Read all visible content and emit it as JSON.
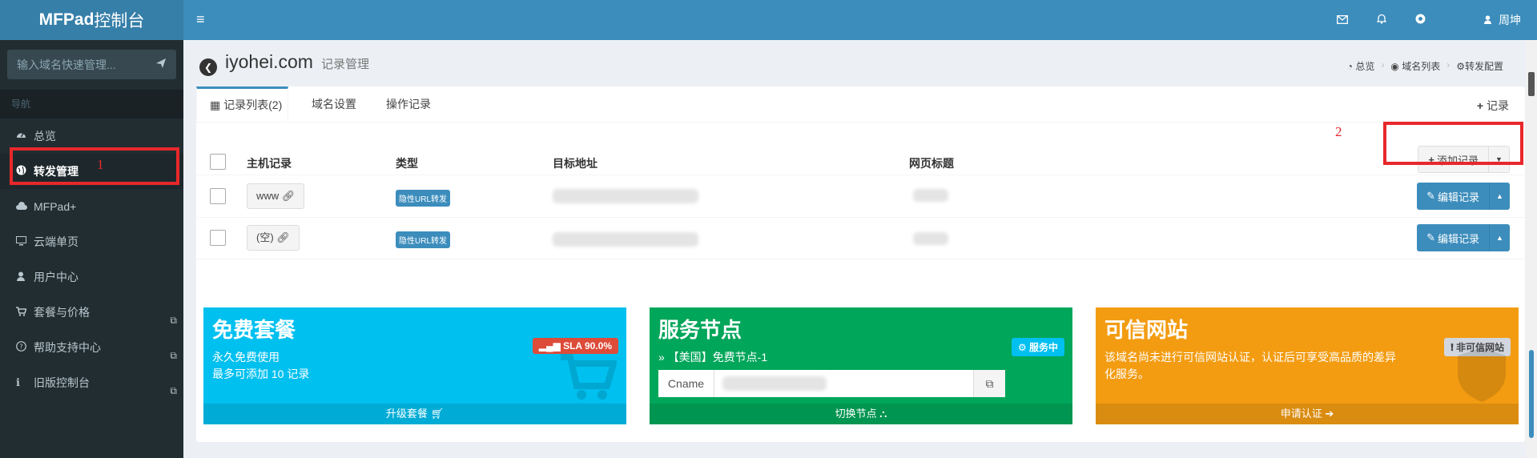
{
  "sidebar": {
    "logo_bold": "MFPad",
    "logo_rest": "控制台",
    "search_placeholder": "输入域名快速管理...",
    "nav_header": "导航",
    "items": [
      {
        "label": "总览",
        "icon": "dashboard-icon"
      },
      {
        "label": "转发管理",
        "icon": "globe-icon",
        "active": true
      },
      {
        "label": "MFPad+",
        "icon": "cloud-icon"
      },
      {
        "label": "云端单页",
        "icon": "desktop-icon"
      },
      {
        "label": "用户中心",
        "icon": "user-icon"
      },
      {
        "label": "套餐与价格",
        "icon": "cart-icon",
        "external": true
      },
      {
        "label": "帮助支持中心",
        "icon": "help-icon",
        "external": true
      },
      {
        "label": "旧版控制台",
        "icon": "info-icon",
        "external": true
      }
    ]
  },
  "topbar": {
    "user_name": "周坤"
  },
  "page": {
    "title": "iyohei.com",
    "subtitle": "记录管理",
    "breadcrumb": [
      "总览",
      "域名列表",
      "转发配置"
    ]
  },
  "tabs": [
    {
      "label": "记录列表(2)",
      "active": true
    },
    {
      "label": "域名设置"
    },
    {
      "label": "操作记录"
    }
  ],
  "tab_add_label": "记录",
  "table": {
    "headers": [
      "主机记录",
      "类型",
      "目标地址",
      "网页标题"
    ],
    "add_button": "添加记录",
    "rows": [
      {
        "host": "www",
        "type": "隐性URL转发",
        "edit": "编辑记录"
      },
      {
        "host": "(空)",
        "type": "隐性URL转发",
        "edit": "编辑记录"
      }
    ]
  },
  "annotations": {
    "one": "1",
    "two": "2"
  },
  "cards": {
    "free": {
      "title": "免费套餐",
      "line1": "永久免费使用",
      "line2": "最多可添加 10 记录",
      "badge": "SLA 90.0%",
      "footer": "升级套餐",
      "color": "#00c0ef"
    },
    "node": {
      "title": "服务节点",
      "line1": "【美国】免费节点-1",
      "badge": "服务中",
      "cname_label": "Cname",
      "footer": "切换节点",
      "color": "#00a65a"
    },
    "trust": {
      "title": "可信网站",
      "line1": "该域名尚未进行可信网站认证，认证后可享受高品质的差异",
      "line2": "化服务。",
      "badge": "非可信网站",
      "footer": "申请认证",
      "color": "#f39c12"
    }
  }
}
